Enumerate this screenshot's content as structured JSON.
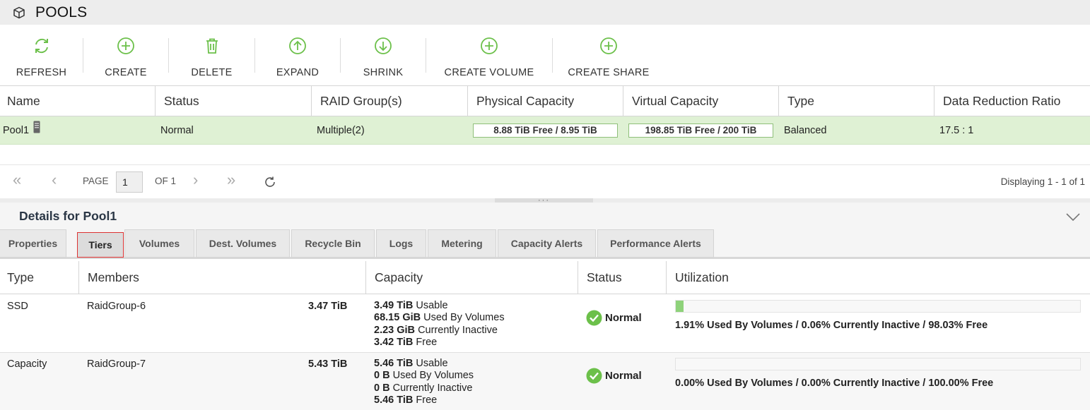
{
  "header": {
    "title": "POOLS",
    "icon": "cube-icon"
  },
  "toolbar": {
    "refresh": "REFRESH",
    "create": "CREATE",
    "delete": "DELETE",
    "expand": "EXPAND",
    "shrink": "SHRINK",
    "create_volume": "CREATE VOLUME",
    "create_share": "CREATE SHARE",
    "icon_color": "#6cc04a"
  },
  "pools_table": {
    "columns": [
      "Name",
      "Status",
      "RAID Group(s)",
      "Physical Capacity",
      "Virtual Capacity",
      "Type",
      "Data Reduction Ratio"
    ],
    "rows": [
      {
        "name": "Pool1",
        "status": "Normal",
        "raid": "Multiple(2)",
        "physical": "8.88 TiB Free / 8.95 TiB",
        "virtual": "198.85 TiB Free / 200 TiB",
        "type": "Balanced",
        "ratio": "17.5 : 1"
      }
    ],
    "selected_row_color": "#dff1d4"
  },
  "pager": {
    "page_label": "PAGE",
    "page_value": "1",
    "of_label": "OF 1",
    "displaying": "Displaying 1 - 1 of 1"
  },
  "details": {
    "title": "Details for Pool1",
    "tabs": [
      "Properties",
      "Tiers",
      "Volumes",
      "Dest. Volumes",
      "Recycle Bin",
      "Logs",
      "Metering",
      "Capacity Alerts",
      "Performance Alerts"
    ],
    "active_tab": "Tiers"
  },
  "tiers_table": {
    "columns": [
      "Type",
      "Members",
      "Capacity",
      "Status",
      "Utilization"
    ],
    "rows": [
      {
        "type": "SSD",
        "member": "RaidGroup-6",
        "member_size": "3.47 TiB",
        "usable_val": "3.49 TiB",
        "usable_lbl": "Usable",
        "used_val": "68.15 GiB",
        "used_lbl": "Used By Volumes",
        "inactive_val": "2.23 GiB",
        "inactive_lbl": "Currently Inactive",
        "free_val": "3.42 TiB",
        "free_lbl": "Free",
        "status": "Normal",
        "used_fraction": 0.0191,
        "utilization": "1.91% Used By Volumes / 0.06% Currently Inactive / 98.03% Free"
      },
      {
        "type": "Capacity",
        "member": "RaidGroup-7",
        "member_size": "5.43 TiB",
        "usable_val": "5.46 TiB",
        "usable_lbl": "Usable",
        "used_val": "0 B",
        "used_lbl": "Used By Volumes",
        "inactive_val": "0 B",
        "inactive_lbl": "Currently Inactive",
        "free_val": "5.46 TiB",
        "free_lbl": "Free",
        "status": "Normal",
        "used_fraction": 0.0,
        "utilization": "0.00% Used By Volumes / 0.00% Currently Inactive / 100.00% Free"
      }
    ],
    "status_color": "#6cc04a"
  }
}
